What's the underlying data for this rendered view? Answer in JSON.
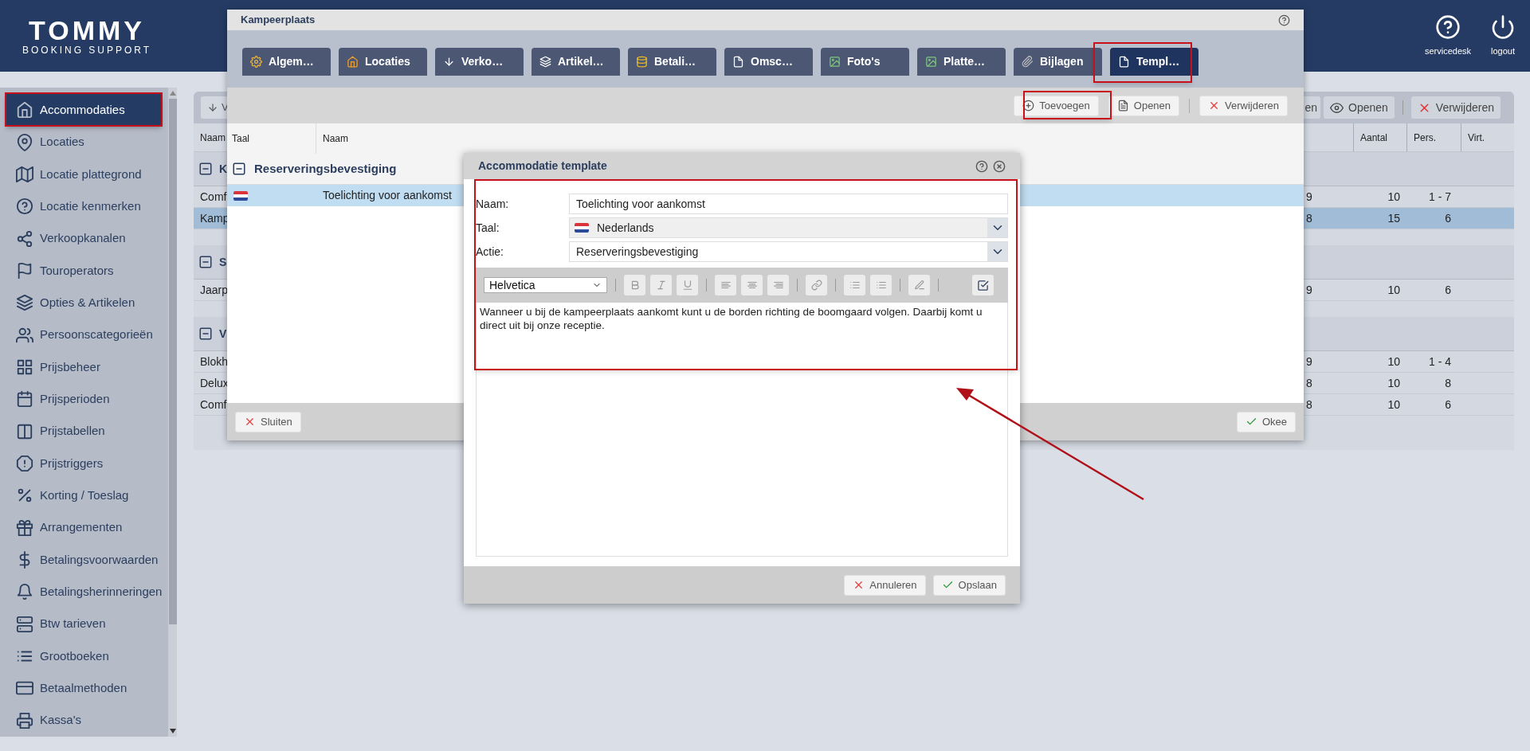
{
  "header": {
    "logo_title": "TOMMY",
    "logo_subtitle": "BOOKING SUPPORT",
    "actions": [
      {
        "label": "servicedesk"
      },
      {
        "label": "logout"
      }
    ]
  },
  "sidebar": {
    "items": [
      {
        "label": "Accommodaties",
        "selected": true
      },
      {
        "label": "Locaties",
        "selected": false
      },
      {
        "label": "Locatie plattegrond",
        "selected": false
      },
      {
        "label": "Locatie kenmerken",
        "selected": false
      },
      {
        "label": "Verkoopkanalen",
        "selected": false
      },
      {
        "label": "Touroperators",
        "selected": false
      },
      {
        "label": "Opties & Artikelen",
        "selected": false
      },
      {
        "label": "Persoonscategorieën",
        "selected": false
      },
      {
        "label": "Prijsbeheer",
        "selected": false
      },
      {
        "label": "Prijsperioden",
        "selected": false
      },
      {
        "label": "Prijstabellen",
        "selected": false
      },
      {
        "label": "Prijstriggers",
        "selected": false
      },
      {
        "label": "Korting / Toeslag",
        "selected": false
      },
      {
        "label": "Arrangementen",
        "selected": false
      },
      {
        "label": "Betalingsvoorwaarden",
        "selected": false
      },
      {
        "label": "Betalingsherinneringen",
        "selected": false
      },
      {
        "label": "Btw tarieven",
        "selected": false
      },
      {
        "label": "Grootboeken",
        "selected": false
      },
      {
        "label": "Betaalmethoden",
        "selected": false
      },
      {
        "label": "Kassa's",
        "selected": false
      }
    ]
  },
  "main": {
    "toolbar": {
      "left_label": "V",
      "buttons": [
        {
          "kind": "plain",
          "label": "en"
        },
        {
          "kind": "view",
          "label": "Openen"
        },
        {
          "kind": "delete",
          "label": "Verwijderen"
        }
      ]
    },
    "table": {
      "columns": {
        "naam": "Naam",
        "aantal": "Aantal",
        "pers": "Pers.",
        "virt": "Virt."
      },
      "rows": [
        {
          "kind": "group",
          "label": "K",
          "expanded": true
        },
        {
          "kind": "row",
          "naam": "Comf",
          "column_2": "9",
          "aantal": "10",
          "pers": "1 - 7",
          "selected": false
        },
        {
          "kind": "row",
          "naam": "Kamp",
          "column_2": "8",
          "aantal": "15",
          "pers": "6",
          "selected": true
        },
        {
          "kind": "spacer"
        },
        {
          "kind": "group",
          "label": "S",
          "expanded": true
        },
        {
          "kind": "row",
          "naam": "Jaarp",
          "column_2": "9",
          "aantal": "10",
          "pers": "6",
          "selected": false
        },
        {
          "kind": "spacer"
        },
        {
          "kind": "group",
          "label": "V",
          "expanded": true
        },
        {
          "kind": "row",
          "naam": "Blokh",
          "column_2": "9",
          "aantal": "10",
          "pers": "1 - 4",
          "selected": false
        },
        {
          "kind": "row",
          "naam": "Delux",
          "column_2": "8",
          "aantal": "10",
          "pers": "8",
          "selected": false
        },
        {
          "kind": "row",
          "naam": "Comf",
          "column_2": "8",
          "aantal": "10",
          "pers": "6",
          "selected": false
        }
      ]
    }
  },
  "dialog": {
    "title": "Kampeerplaats",
    "tabs": [
      {
        "label": "Algem…",
        "selected": false
      },
      {
        "label": "Locaties",
        "selected": false
      },
      {
        "label": "Verko…",
        "selected": false
      },
      {
        "label": "Artikel…",
        "selected": false
      },
      {
        "label": "Betali…",
        "selected": false
      },
      {
        "label": "Omsc…",
        "selected": false
      },
      {
        "label": "Foto's",
        "selected": false
      },
      {
        "label": "Platte…",
        "selected": false
      },
      {
        "label": "Bijlagen",
        "selected": false
      },
      {
        "label": "Templ…",
        "selected": true
      }
    ],
    "toolbar": [
      {
        "kind": "add",
        "label": "Toevoegen"
      },
      {
        "kind": "open",
        "label": "Openen"
      },
      {
        "kind": "delete",
        "label": "Verwijderen"
      }
    ],
    "columns": [
      "Taal",
      "Naam"
    ],
    "groups": [
      {
        "label": "Reserveringsbevestiging",
        "expanded": true,
        "rows": [
          {
            "name": "Toelichting voor aankomst",
            "selected": true
          }
        ]
      }
    ],
    "footer": [
      {
        "kind": "close",
        "label": "Sluiten"
      },
      {
        "kind": "ok",
        "label": "Okee"
      }
    ]
  },
  "template_dialog": {
    "title": "Accommodatie template",
    "fields": [
      {
        "label": "Naam:",
        "kind": "text",
        "value": "Toelichting voor aankomst"
      },
      {
        "label": "Taal:",
        "kind": "language",
        "value": "Nederlands"
      },
      {
        "label": "Actie:",
        "kind": "select",
        "value": "Reserveringsbevestiging"
      }
    ],
    "editor": {
      "font": "Helvetica",
      "body": "Wanneer u bij de kampeerplaats aankomt kunt u de borden richting de boomgaard volgen. Daarbij komt u direct uit bij onze receptie."
    },
    "footer": [
      {
        "kind": "cancel",
        "label": "Annuleren"
      },
      {
        "kind": "ok",
        "label": "Opslaan"
      }
    ]
  }
}
